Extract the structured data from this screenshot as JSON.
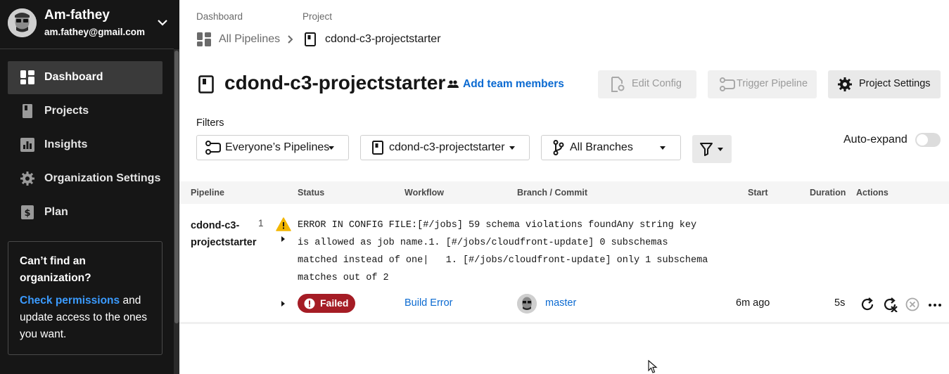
{
  "user": {
    "name": "Am-fathey",
    "email": "am.fathey@gmail.com"
  },
  "sidebar": {
    "items": [
      {
        "label": "Dashboard",
        "icon": "dashboard-icon",
        "active": true
      },
      {
        "label": "Projects",
        "icon": "book-icon",
        "active": false
      },
      {
        "label": "Insights",
        "icon": "chart-icon",
        "active": false
      },
      {
        "label": "Organization Settings",
        "icon": "gear-icon",
        "active": false
      },
      {
        "label": "Plan",
        "icon": "dollar-icon",
        "active": false
      }
    ],
    "help": {
      "title": "Can’t find an organization?",
      "link": "Check permissions",
      "text_after": " and update access to the ones you want."
    }
  },
  "breadcrumb": {
    "dashboard_label": "Dashboard",
    "project_label": "Project",
    "all_pipelines": "All Pipelines",
    "project_name": "cdond-c3-projectstarter"
  },
  "header": {
    "title": "cdond-c3-projectstarter",
    "add_team": "Add team members",
    "edit_config": "Edit Config",
    "trigger_pipeline": "Trigger Pipeline",
    "project_settings": "Project Settings"
  },
  "filters": {
    "label": "Filters",
    "pipelines": "Everyone’s Pipelines",
    "project": "cdond-c3-projectstarter",
    "branches": "All Branches",
    "auto_expand": "Auto-expand"
  },
  "table": {
    "headers": [
      "Pipeline",
      "Status",
      "Workflow",
      "Branch / Commit",
      "Start",
      "Duration",
      "Actions"
    ]
  },
  "pipeline_row": {
    "name": "cdond-c3-projectstarter",
    "number": "1",
    "error": "ERROR IN CONFIG FILE:[#/jobs] 59 schema violations foundAny string key\nis allowed as job name.1. [#/jobs/cloudfront-update] 0 subschemas\nmatched instead of one|   1. [#/jobs/cloudfront-update] only 1 subschema\nmatches out of 2",
    "status": "Failed",
    "workflow": "Build Error",
    "branch": "master",
    "start": "6m ago",
    "duration": "5s"
  },
  "colors": {
    "sidebar_bg": "#161616",
    "accent_link": "#0b6ad1",
    "failed_badge": "#a51c25",
    "warning": "#f2b600"
  }
}
